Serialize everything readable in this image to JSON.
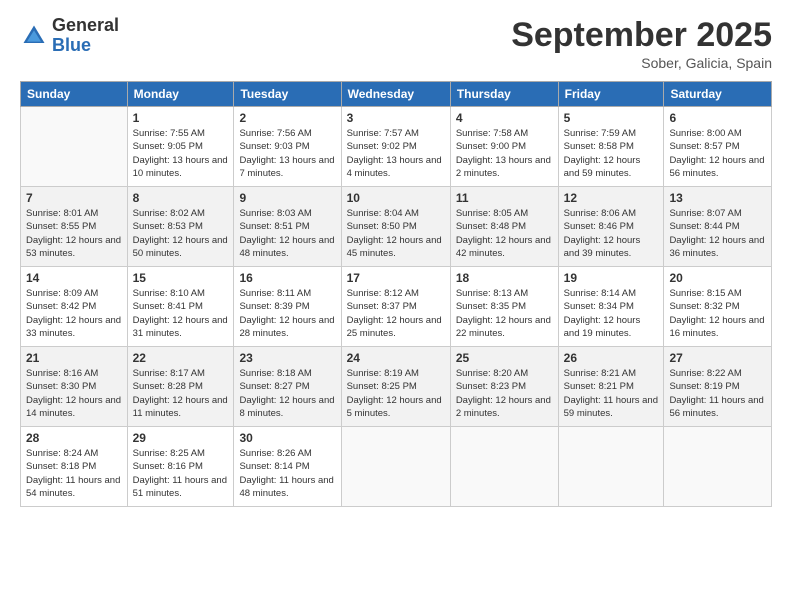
{
  "logo": {
    "general": "General",
    "blue": "Blue"
  },
  "title": "September 2025",
  "subtitle": "Sober, Galicia, Spain",
  "days_header": [
    "Sunday",
    "Monday",
    "Tuesday",
    "Wednesday",
    "Thursday",
    "Friday",
    "Saturday"
  ],
  "weeks": [
    [
      {
        "num": "",
        "sunrise": "",
        "sunset": "",
        "daylight": ""
      },
      {
        "num": "1",
        "sunrise": "Sunrise: 7:55 AM",
        "sunset": "Sunset: 9:05 PM",
        "daylight": "Daylight: 13 hours and 10 minutes."
      },
      {
        "num": "2",
        "sunrise": "Sunrise: 7:56 AM",
        "sunset": "Sunset: 9:03 PM",
        "daylight": "Daylight: 13 hours and 7 minutes."
      },
      {
        "num": "3",
        "sunrise": "Sunrise: 7:57 AM",
        "sunset": "Sunset: 9:02 PM",
        "daylight": "Daylight: 13 hours and 4 minutes."
      },
      {
        "num": "4",
        "sunrise": "Sunrise: 7:58 AM",
        "sunset": "Sunset: 9:00 PM",
        "daylight": "Daylight: 13 hours and 2 minutes."
      },
      {
        "num": "5",
        "sunrise": "Sunrise: 7:59 AM",
        "sunset": "Sunset: 8:58 PM",
        "daylight": "Daylight: 12 hours and 59 minutes."
      },
      {
        "num": "6",
        "sunrise": "Sunrise: 8:00 AM",
        "sunset": "Sunset: 8:57 PM",
        "daylight": "Daylight: 12 hours and 56 minutes."
      }
    ],
    [
      {
        "num": "7",
        "sunrise": "Sunrise: 8:01 AM",
        "sunset": "Sunset: 8:55 PM",
        "daylight": "Daylight: 12 hours and 53 minutes."
      },
      {
        "num": "8",
        "sunrise": "Sunrise: 8:02 AM",
        "sunset": "Sunset: 8:53 PM",
        "daylight": "Daylight: 12 hours and 50 minutes."
      },
      {
        "num": "9",
        "sunrise": "Sunrise: 8:03 AM",
        "sunset": "Sunset: 8:51 PM",
        "daylight": "Daylight: 12 hours and 48 minutes."
      },
      {
        "num": "10",
        "sunrise": "Sunrise: 8:04 AM",
        "sunset": "Sunset: 8:50 PM",
        "daylight": "Daylight: 12 hours and 45 minutes."
      },
      {
        "num": "11",
        "sunrise": "Sunrise: 8:05 AM",
        "sunset": "Sunset: 8:48 PM",
        "daylight": "Daylight: 12 hours and 42 minutes."
      },
      {
        "num": "12",
        "sunrise": "Sunrise: 8:06 AM",
        "sunset": "Sunset: 8:46 PM",
        "daylight": "Daylight: 12 hours and 39 minutes."
      },
      {
        "num": "13",
        "sunrise": "Sunrise: 8:07 AM",
        "sunset": "Sunset: 8:44 PM",
        "daylight": "Daylight: 12 hours and 36 minutes."
      }
    ],
    [
      {
        "num": "14",
        "sunrise": "Sunrise: 8:09 AM",
        "sunset": "Sunset: 8:42 PM",
        "daylight": "Daylight: 12 hours and 33 minutes."
      },
      {
        "num": "15",
        "sunrise": "Sunrise: 8:10 AM",
        "sunset": "Sunset: 8:41 PM",
        "daylight": "Daylight: 12 hours and 31 minutes."
      },
      {
        "num": "16",
        "sunrise": "Sunrise: 8:11 AM",
        "sunset": "Sunset: 8:39 PM",
        "daylight": "Daylight: 12 hours and 28 minutes."
      },
      {
        "num": "17",
        "sunrise": "Sunrise: 8:12 AM",
        "sunset": "Sunset: 8:37 PM",
        "daylight": "Daylight: 12 hours and 25 minutes."
      },
      {
        "num": "18",
        "sunrise": "Sunrise: 8:13 AM",
        "sunset": "Sunset: 8:35 PM",
        "daylight": "Daylight: 12 hours and 22 minutes."
      },
      {
        "num": "19",
        "sunrise": "Sunrise: 8:14 AM",
        "sunset": "Sunset: 8:34 PM",
        "daylight": "Daylight: 12 hours and 19 minutes."
      },
      {
        "num": "20",
        "sunrise": "Sunrise: 8:15 AM",
        "sunset": "Sunset: 8:32 PM",
        "daylight": "Daylight: 12 hours and 16 minutes."
      }
    ],
    [
      {
        "num": "21",
        "sunrise": "Sunrise: 8:16 AM",
        "sunset": "Sunset: 8:30 PM",
        "daylight": "Daylight: 12 hours and 14 minutes."
      },
      {
        "num": "22",
        "sunrise": "Sunrise: 8:17 AM",
        "sunset": "Sunset: 8:28 PM",
        "daylight": "Daylight: 12 hours and 11 minutes."
      },
      {
        "num": "23",
        "sunrise": "Sunrise: 8:18 AM",
        "sunset": "Sunset: 8:27 PM",
        "daylight": "Daylight: 12 hours and 8 minutes."
      },
      {
        "num": "24",
        "sunrise": "Sunrise: 8:19 AM",
        "sunset": "Sunset: 8:25 PM",
        "daylight": "Daylight: 12 hours and 5 minutes."
      },
      {
        "num": "25",
        "sunrise": "Sunrise: 8:20 AM",
        "sunset": "Sunset: 8:23 PM",
        "daylight": "Daylight: 12 hours and 2 minutes."
      },
      {
        "num": "26",
        "sunrise": "Sunrise: 8:21 AM",
        "sunset": "Sunset: 8:21 PM",
        "daylight": "Daylight: 11 hours and 59 minutes."
      },
      {
        "num": "27",
        "sunrise": "Sunrise: 8:22 AM",
        "sunset": "Sunset: 8:19 PM",
        "daylight": "Daylight: 11 hours and 56 minutes."
      }
    ],
    [
      {
        "num": "28",
        "sunrise": "Sunrise: 8:24 AM",
        "sunset": "Sunset: 8:18 PM",
        "daylight": "Daylight: 11 hours and 54 minutes."
      },
      {
        "num": "29",
        "sunrise": "Sunrise: 8:25 AM",
        "sunset": "Sunset: 8:16 PM",
        "daylight": "Daylight: 11 hours and 51 minutes."
      },
      {
        "num": "30",
        "sunrise": "Sunrise: 8:26 AM",
        "sunset": "Sunset: 8:14 PM",
        "daylight": "Daylight: 11 hours and 48 minutes."
      },
      {
        "num": "",
        "sunrise": "",
        "sunset": "",
        "daylight": ""
      },
      {
        "num": "",
        "sunrise": "",
        "sunset": "",
        "daylight": ""
      },
      {
        "num": "",
        "sunrise": "",
        "sunset": "",
        "daylight": ""
      },
      {
        "num": "",
        "sunrise": "",
        "sunset": "",
        "daylight": ""
      }
    ]
  ]
}
